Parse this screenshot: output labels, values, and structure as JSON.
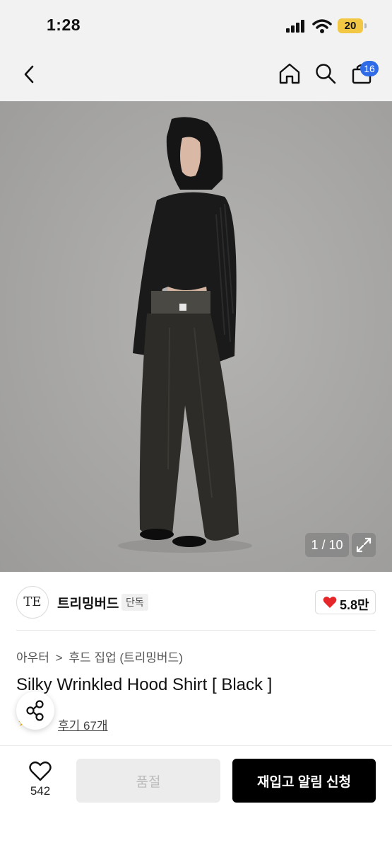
{
  "status_bar": {
    "time": "1:28",
    "battery": "20"
  },
  "nav": {
    "cart_count": "16"
  },
  "gallery": {
    "counter": "1 / 10"
  },
  "brand": {
    "logo_text": "TE",
    "name": "트리밍버드",
    "exclusive_tag": "단독",
    "likes": "5.8만"
  },
  "breadcrumb": {
    "category": "아우터",
    "separator": ">",
    "subcategory": "후드 집업 (트리밍버드)"
  },
  "product": {
    "title": "Silky Wrinkled Hood Shirt [ Black ]",
    "reviews": "후기 67개"
  },
  "bottom_bar": {
    "wish_count": "542",
    "soldout_label": "품절",
    "restock_label": "재입고 알림 신청"
  },
  "colors": {
    "accent_blue": "#2f6be6",
    "heart_red": "#e5262b",
    "black": "#000000"
  },
  "icons": [
    "back-arrow-icon",
    "home-icon",
    "search-icon",
    "shopping-bag-icon",
    "expand-icon",
    "heart-icon",
    "share-icon",
    "star-icon"
  ]
}
